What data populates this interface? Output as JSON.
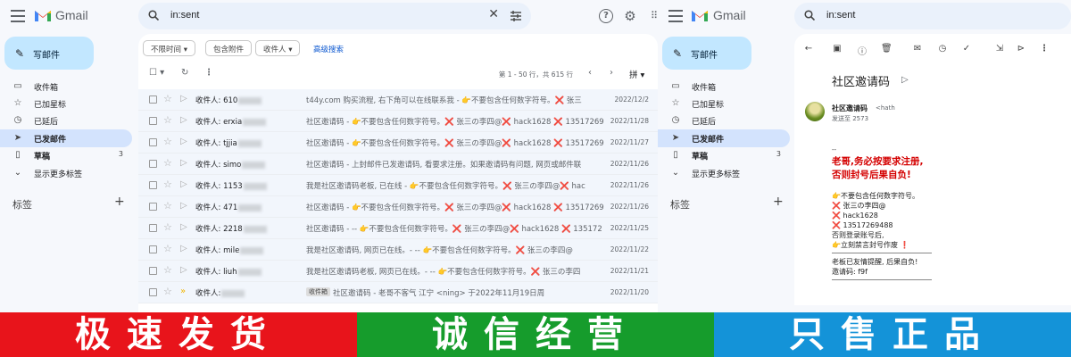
{
  "left": {
    "app_name": "Gmail",
    "search": {
      "value": "in:sent"
    },
    "compose_label": "写邮件",
    "nav": [
      {
        "label": "收件箱",
        "icon": "inbox-icon",
        "count": ""
      },
      {
        "label": "已加星标",
        "icon": "star-icon",
        "count": ""
      },
      {
        "label": "已延后",
        "icon": "clock-icon",
        "count": ""
      },
      {
        "label": "已发邮件",
        "icon": "send-icon",
        "count": "",
        "selected": true
      },
      {
        "label": "草稿",
        "icon": "draft-icon",
        "count": "3",
        "bold": true
      },
      {
        "label": "显示更多标签",
        "icon": "chevron-down-icon",
        "count": ""
      }
    ],
    "labels_heading": "标签",
    "filters": [
      "不限时间",
      "包含附件",
      "收件人"
    ],
    "advanced_search": "高级搜索",
    "pagination": "第 1 - 50 行，共 615 行",
    "emails": [
      {
        "to": "收件人: 610",
        "subject": "t44y.com 购买流程, 右下角可以在线联系我 - 👉不要包含任何数字符号。❌ 张三",
        "date": "2022/12/2",
        "important": false,
        "tag": ""
      },
      {
        "to": "收件人: erxia",
        "subject": "社区邀请码 - 👉不要包含任何数字符号。❌ 张三の李四@❌ hack1628 ❌ 13517269",
        "date": "2022/11/28",
        "important": false,
        "tag": ""
      },
      {
        "to": "收件人: tjjia",
        "subject": "社区邀请码 - 👉不要包含任何数字符号。❌ 张三の李四@❌ hack1628 ❌ 13517269",
        "date": "2022/11/27",
        "important": false,
        "tag": ""
      },
      {
        "to": "收件人: simo",
        "subject": "社区邀请码 - 上封邮件已发邀请码, 看要求注册。如果邀请码有问题, 网页或邮件联",
        "date": "2022/11/26",
        "important": false,
        "tag": ""
      },
      {
        "to": "收件人: 1153",
        "subject": "我是社区邀请码老板, 已在线 - 👉不要包含任何数字符号。❌ 张三の李四@❌ hac",
        "date": "2022/11/26",
        "important": false,
        "tag": ""
      },
      {
        "to": "收件人: 471",
        "subject": "社区邀请码 - 👉不要包含任何数字符号。❌ 张三の李四@❌ hack1628 ❌ 13517269",
        "date": "2022/11/26",
        "important": false,
        "tag": ""
      },
      {
        "to": "收件人: 2218",
        "subject": "社区邀请码 - -- 👉不要包含任何数字符号。❌ 张三の李四@❌ hack1628 ❌ 135172",
        "date": "2022/11/25",
        "important": false,
        "tag": ""
      },
      {
        "to": "收件人: mile",
        "subject": "我是社区邀请码, 网页已在线。- -- 👉不要包含任何数字符号。❌ 张三の李四@",
        "date": "2022/11/22",
        "important": false,
        "tag": ""
      },
      {
        "to": "收件人: liuh",
        "subject": "我是社区邀请码老板, 网页已在线。- -- 👉不要包含任何数字符号。❌ 张三の李四",
        "date": "2022/11/21",
        "important": false,
        "tag": ""
      },
      {
        "to": "收件人:",
        "subject": "社区邀请码 - 老哥不客气 江宁 <ning> 于2022年11月19日周",
        "date": "2022/11/20",
        "important": true,
        "tag": "收件箱"
      }
    ]
  },
  "right": {
    "app_name": "Gmail",
    "search": {
      "value": "in:sent"
    },
    "compose_label": "写邮件",
    "nav": [
      {
        "label": "收件箱",
        "icon": "inbox-icon",
        "count": ""
      },
      {
        "label": "已加星标",
        "icon": "star-icon",
        "count": ""
      },
      {
        "label": "已延后",
        "icon": "clock-icon",
        "count": ""
      },
      {
        "label": "已发邮件",
        "icon": "send-icon",
        "count": "",
        "selected": true
      },
      {
        "label": "草稿",
        "icon": "draft-icon",
        "count": "3",
        "bold": true
      },
      {
        "label": "显示更多标签",
        "icon": "chevron-down-icon",
        "count": ""
      }
    ],
    "labels_heading": "标签",
    "message": {
      "subject": "社区邀请码",
      "sender_name": "社区邀请码",
      "sender_email": "<hath",
      "to": "发送至 2573",
      "dash": "--",
      "warning": [
        "老哥,务必按要求注册,",
        "否则封号后果自负!"
      ],
      "lines": [
        "👉不要包含任何数字符号。",
        "❌ 张三の李四@",
        "❌ hack1628",
        "❌ 13517269488",
        "否则登录账号后,",
        "👉立刻禁言封号作废 ❗"
      ],
      "footer": [
        "老板已友情提醒, 后果自负!",
        "邀请码: f9f"
      ]
    }
  },
  "banner": [
    {
      "text": "极速发货",
      "color": "#e8141b"
    },
    {
      "text": "诚信经营",
      "color": "#169c2c"
    },
    {
      "text": "只售正品",
      "color": "#1493d8"
    }
  ]
}
